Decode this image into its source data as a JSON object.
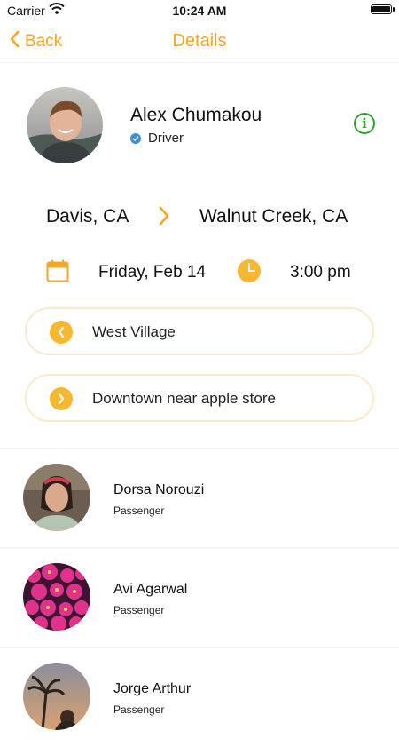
{
  "status_bar": {
    "carrier": "Carrier",
    "time": "10:24 AM"
  },
  "nav": {
    "back_label": "Back",
    "title": "Details"
  },
  "driver": {
    "name": "Alex Chumakou",
    "role": "Driver"
  },
  "route": {
    "from": "Davis, CA",
    "to": "Walnut Creek, CA"
  },
  "schedule": {
    "date": "Friday, Feb 14",
    "time": "3:00 pm"
  },
  "stops": [
    {
      "label": "West Village",
      "direction": "left"
    },
    {
      "label": "Downtown near apple store",
      "direction": "right"
    }
  ],
  "passengers": [
    {
      "name": "Dorsa Norouzi",
      "role": "Passenger"
    },
    {
      "name": "Avi Agarwal",
      "role": "Passenger"
    },
    {
      "name": "Jorge Arthur",
      "role": "Passenger"
    }
  ],
  "colors": {
    "accent": "#f5a623",
    "stop_circle": "#f7b731",
    "info": "#2aa52a",
    "verified": "#3b8fd9"
  },
  "icons": {
    "back": "chevron-left-icon",
    "info": "info-icon",
    "verified": "verified-icon",
    "route_arrow": "chevron-right-icon",
    "calendar": "calendar-icon",
    "clock": "clock-icon"
  }
}
